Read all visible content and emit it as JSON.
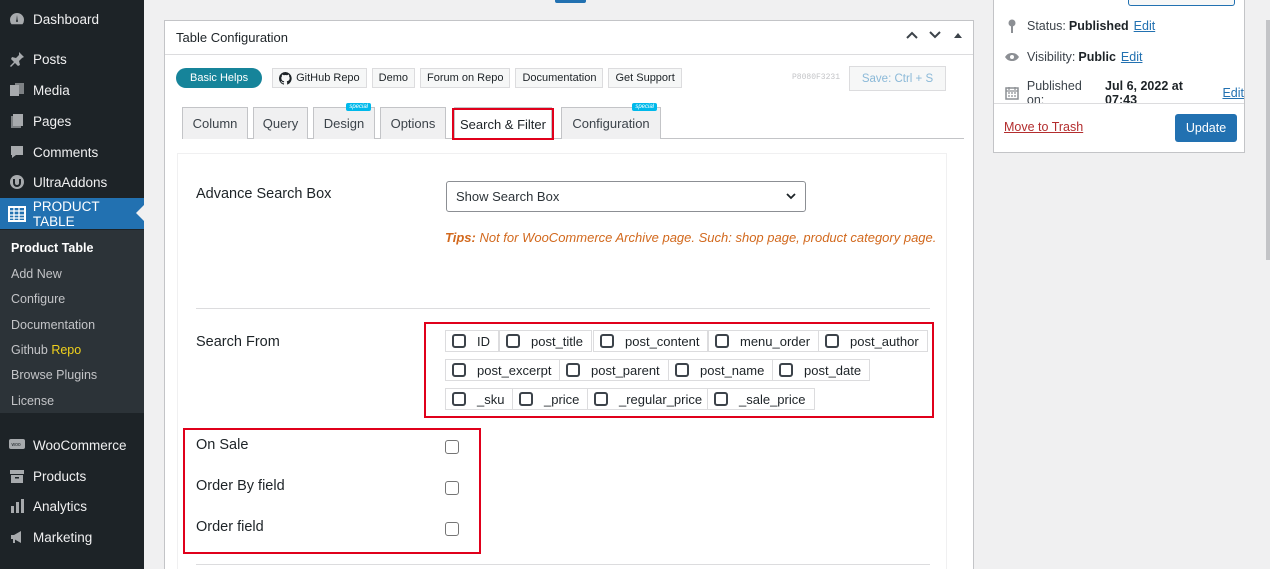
{
  "sidebar": {
    "items": [
      {
        "label": "Dashboard",
        "icon": "dashboard-icon"
      },
      {
        "label": "Posts",
        "icon": "pin-icon"
      },
      {
        "label": "Media",
        "icon": "media-icon"
      },
      {
        "label": "Pages",
        "icon": "pages-icon"
      },
      {
        "label": "Comments",
        "icon": "comments-icon"
      },
      {
        "label": "UltraAddons",
        "icon": "ultraaddons-icon"
      },
      {
        "label": "PRODUCT TABLE",
        "icon": "table-icon"
      },
      {
        "label": "WooCommerce",
        "icon": "woo-icon"
      },
      {
        "label": "Products",
        "icon": "archive-icon"
      },
      {
        "label": "Analytics",
        "icon": "bar-chart-icon"
      },
      {
        "label": "Marketing",
        "icon": "megaphone-icon"
      }
    ],
    "submenu": {
      "product_table": "Product Table",
      "add_new": "Add New",
      "configure": "Configure",
      "documentation": "Documentation",
      "github_prefix": "Github",
      "github_repo": "Repo",
      "browse_plugins": "Browse Plugins",
      "license": "License"
    }
  },
  "panel": {
    "title": "Table Configuration",
    "basic_helps": "Basic Helps",
    "links": [
      "GitHub Repo",
      "Demo",
      "Forum on Repo",
      "Documentation",
      "Get Support"
    ],
    "hash": "P8080F3231",
    "save_label": "Save: Ctrl + S",
    "tabs": [
      {
        "label": "Column"
      },
      {
        "label": "Query"
      },
      {
        "label": "Design",
        "badge": "special"
      },
      {
        "label": "Options"
      },
      {
        "label": "Search & Filter"
      },
      {
        "label": "Configuration",
        "badge": "special"
      }
    ]
  },
  "search_filter": {
    "advance_search_label": "Advance Search Box",
    "advance_search_value": "Show Search Box",
    "tips_label": "Tips:",
    "tips_text": "Not for WooCommerce Archive page. Such: shop page, product category page.",
    "search_from_label": "Search From",
    "search_from_options": [
      "ID",
      "post_title",
      "post_content",
      "menu_order",
      "post_author",
      "post_excerpt",
      "post_parent",
      "post_name",
      "post_date",
      "_sku",
      "_price",
      "_regular_price",
      "_sale_price"
    ],
    "on_sale_label": "On Sale",
    "order_by_label": "Order By field",
    "order_label": "Order field"
  },
  "publish": {
    "status_label": "Status:",
    "status_value": "Published",
    "visibility_label": "Visibility:",
    "visibility_value": "Public",
    "published_label": "Published on:",
    "published_value": "Jul 6, 2022 at 07:43",
    "edit": "Edit",
    "trash": "Move to Trash",
    "update": "Update"
  },
  "colors": {
    "sidebar_bg": "#1d2327",
    "accent": "#2271b1",
    "highlight_box": "#e0001b",
    "tips": "#d2691e",
    "basic_helps": "#16849a"
  }
}
